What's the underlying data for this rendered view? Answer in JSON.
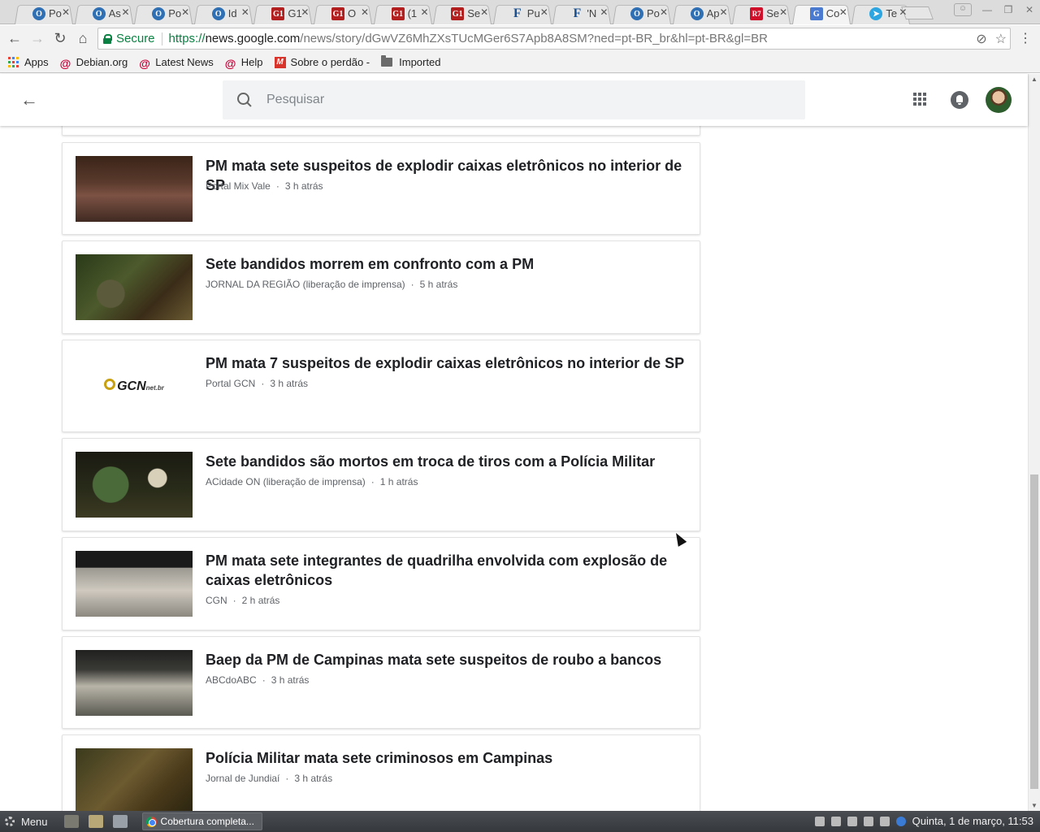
{
  "browser": {
    "tabs": [
      {
        "label": "Po",
        "favicon": "o-icon",
        "active": false
      },
      {
        "label": "As",
        "favicon": "o-icon",
        "active": false
      },
      {
        "label": "Po",
        "favicon": "o-icon",
        "active": false
      },
      {
        "label": "Id",
        "favicon": "o-icon",
        "active": false
      },
      {
        "label": "G1",
        "favicon": "g1-icon",
        "active": false
      },
      {
        "label": "O",
        "favicon": "g1-icon",
        "active": false
      },
      {
        "label": "(1",
        "favicon": "g1-icon",
        "active": false
      },
      {
        "label": "Se",
        "favicon": "g1-icon",
        "active": false
      },
      {
        "label": "Pu",
        "favicon": "f-icon",
        "active": false
      },
      {
        "label": "'N",
        "favicon": "f-icon",
        "active": false
      },
      {
        "label": "Po",
        "favicon": "o-icon",
        "active": false
      },
      {
        "label": "Ap",
        "favicon": "o-icon",
        "active": false
      },
      {
        "label": "Se",
        "favicon": "r7-icon",
        "active": false
      },
      {
        "label": "Co",
        "favicon": "google-news-icon",
        "active": true
      },
      {
        "label": "Te",
        "favicon": "telegram-icon",
        "active": false
      }
    ],
    "secure_label": "Secure",
    "url_scheme": "https://",
    "url_host": "news.google.com",
    "url_rest": "/news/story/dGwVZ6MhZXsTUcMGer6S7Apb8A8SM?ned=pt-BR_br&hl=pt-BR&gl=BR"
  },
  "bookmarks": [
    {
      "label": "Apps",
      "icon": "apps-grid-icon"
    },
    {
      "label": "Debian.org",
      "icon": "debian-icon"
    },
    {
      "label": "Latest News",
      "icon": "debian-icon"
    },
    {
      "label": "Help",
      "icon": "debian-icon"
    },
    {
      "label": "Sobre o perdão -",
      "icon": "m-badge-icon"
    },
    {
      "label": "Imported",
      "icon": "folder-icon"
    }
  ],
  "header": {
    "search_placeholder": "Pesquisar"
  },
  "articles": [
    {
      "title": "PM mata sete suspeitos de explodir caixas eletrônicos no interior de SP",
      "source": "Portal Mix Vale",
      "time": "3 h atrás"
    },
    {
      "title": "Sete bandidos morrem em confronto com a PM",
      "source": "JORNAL DA REGIÃO (liberação de imprensa)",
      "time": "5 h atrás"
    },
    {
      "title": "PM mata 7 suspeitos de explodir caixas eletrônicos no interior de SP",
      "source": "Portal GCN",
      "time": "3 h atrás"
    },
    {
      "title": "Sete bandidos são mortos em troca de tiros com a Polícia Militar",
      "source": "ACidade ON (liberação de imprensa)",
      "time": "1 h atrás"
    },
    {
      "title": "PM mata sete integrantes de quadrilha envolvida com explosão de caixas eletrônicos",
      "source": "CGN",
      "time": "2 h atrás"
    },
    {
      "title": "Baep da PM de Campinas mata sete suspeitos de roubo a bancos",
      "source": "ABCdoABC",
      "time": "3 h atrás"
    },
    {
      "title": "Polícia Militar mata sete criminosos em Campinas",
      "source": "Jornal de Jundiaí",
      "time": "3 h atrás"
    }
  ],
  "gcn_logo": {
    "text": "GCN",
    "suffix": "net.br"
  },
  "taskbar": {
    "menu_label": "Menu",
    "window_label": "Cobertura completa...",
    "clock": "Quinta,  1 de março, 11:53"
  },
  "colors": {
    "secure_green": "#0b8043",
    "title_text": "#202124",
    "meta_text": "#5f6368"
  }
}
